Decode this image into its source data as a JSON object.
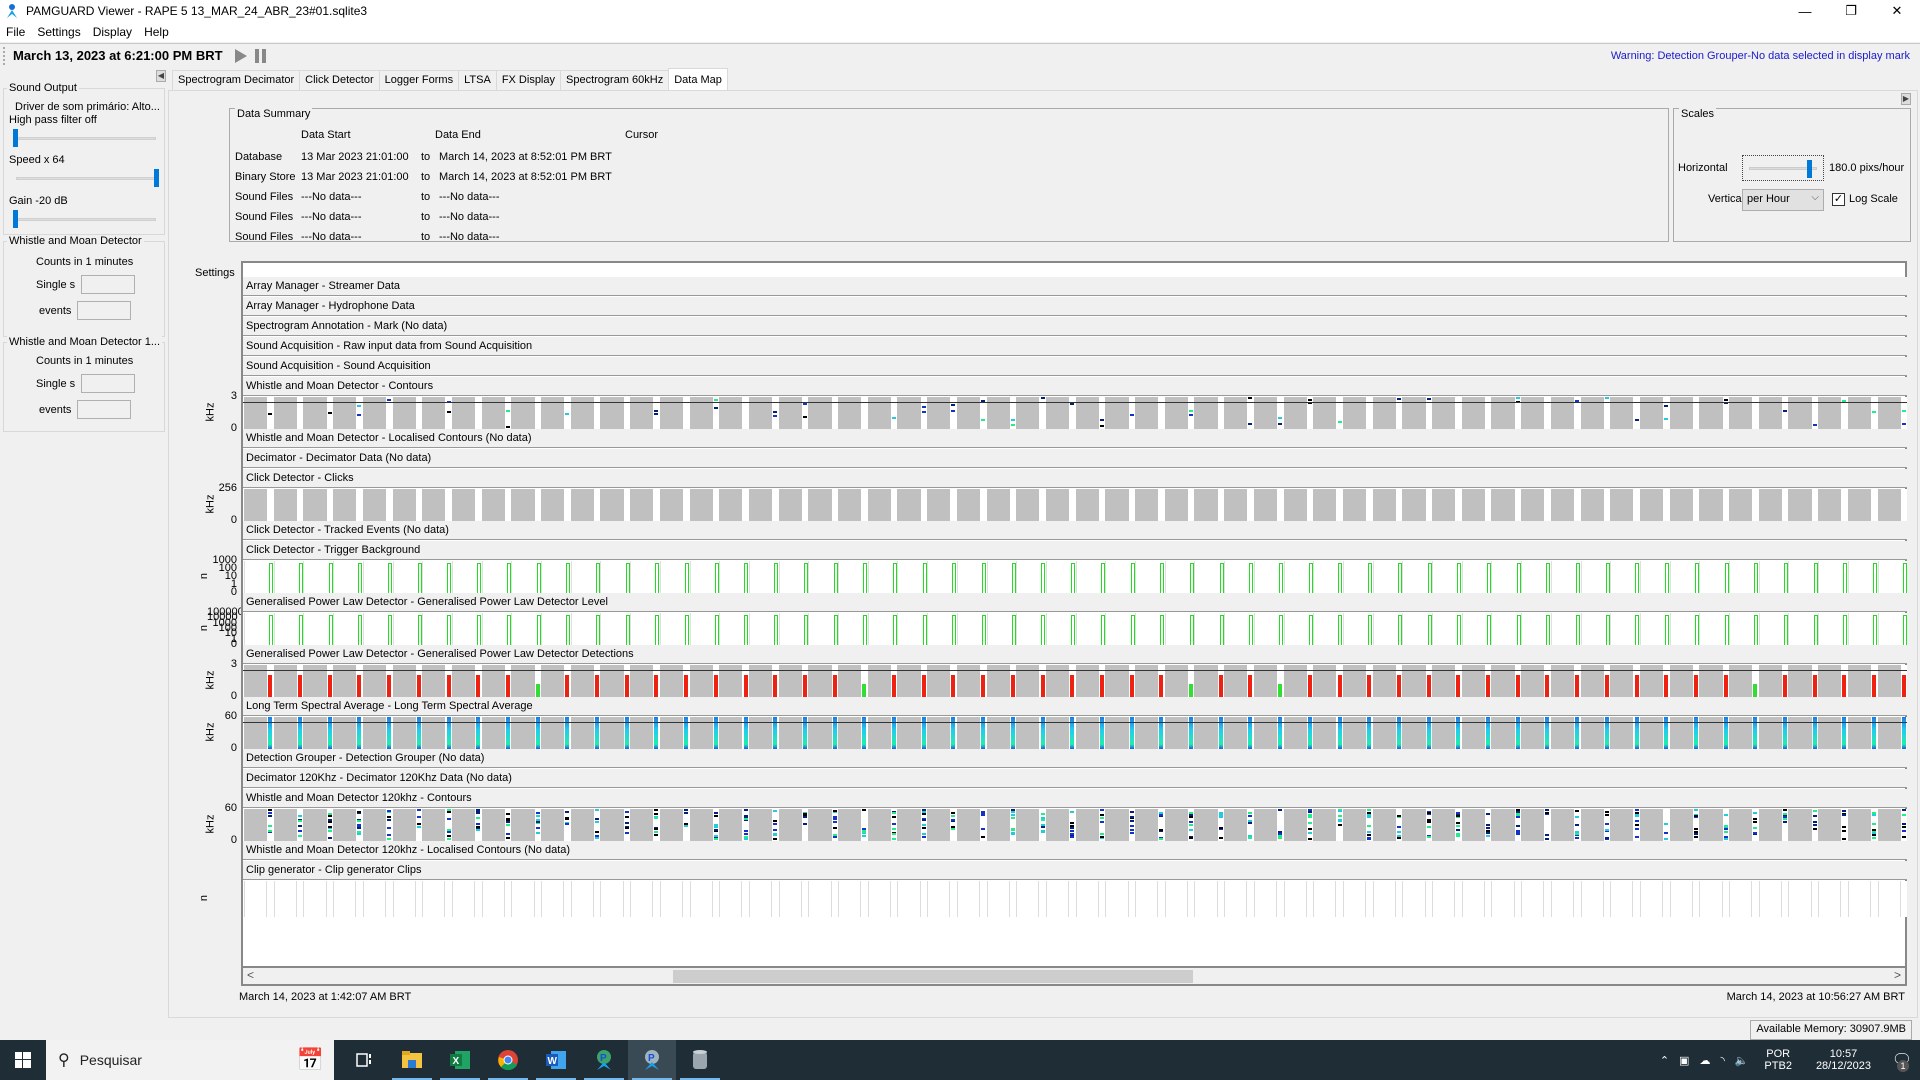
{
  "window": {
    "title": "PAMGUARD Viewer - RAPE 5 13_MAR_24_ABR_23#01.sqlite3",
    "controls": {
      "minimize": "—",
      "restore": "❐",
      "close": "✕"
    }
  },
  "menu": [
    "File",
    "Settings",
    "Display",
    "Help"
  ],
  "toolbar": {
    "clock": "March 13, 2023 at 6:21:00 PM BRT",
    "warning": "Warning: Detection Grouper-No data selected in display mark"
  },
  "left_panel": {
    "sound_output": {
      "title": "Sound Output",
      "driver": "Driver de som primário: Alto...",
      "high_pass": "High pass filter off",
      "high_pass_fraction": 0.0,
      "speed": "Speed  x 64",
      "speed_fraction": 1.0,
      "gain": "Gain -20 dB",
      "gain_fraction": 0.0
    },
    "wmd1": {
      "title": "Whistle and Moan Detector",
      "counts": "Counts in 1 minutes",
      "single": "Single s",
      "events": "events",
      "single_value": "",
      "events_value": ""
    },
    "wmd2": {
      "title": "Whistle and Moan Detector 1...",
      "counts": "Counts in 1 minutes",
      "single": "Single s",
      "events": "events",
      "single_value": "",
      "events_value": ""
    }
  },
  "tabs": [
    "Spectrogram Decimator",
    "Click Detector",
    "Logger Forms",
    "LTSA",
    "FX Display",
    "Spectrogram 60kHz",
    "Data Map"
  ],
  "active_tab": "Data Map",
  "data_summary": {
    "title": "Data Summary",
    "headers": {
      "start": "Data Start",
      "end": "Data End",
      "cursor": "Cursor"
    },
    "rows": [
      {
        "name": "Database",
        "start": "13 Mar 2023 21:01:00",
        "to": "to",
        "end": "March 14, 2023 at 8:52:01 PM BRT"
      },
      {
        "name": "Binary Store",
        "start": "13 Mar 2023 21:01:00",
        "to": "to",
        "end": "March 14, 2023 at 8:52:01 PM BRT"
      },
      {
        "name": "Sound Files",
        "start": "---No data---",
        "to": "to",
        "end": "---No data---"
      },
      {
        "name": "Sound Files",
        "start": "---No data---",
        "to": "to",
        "end": "---No data---"
      },
      {
        "name": "Sound Files",
        "start": "---No data---",
        "to": "to",
        "end": "---No data---"
      }
    ]
  },
  "scales": {
    "title": "Scales",
    "horizontal_label": "Horizontal",
    "horizontal_value": "180.0 pixs/hour",
    "vertical_label": "Vertical",
    "vertical_value": "per Hour",
    "log_scale_label": "Log Scale",
    "log_scale_checked": true,
    "check_glyph": "✓"
  },
  "datamap": {
    "settings_label": "Settings",
    "strips": [
      {
        "label": "Array Manager - Streamer Data"
      },
      {
        "label": "Array Manager - Hydrophone Data"
      },
      {
        "label": "Spectrogram Annotation - Mark  (No data)"
      },
      {
        "label": "Sound Acquisition - Raw input data from Sound Acquisition"
      },
      {
        "label": "Sound Acquisition - Sound Acquisition"
      },
      {
        "label": "Whistle and Moan Detector - Contours",
        "plot": "contours",
        "yunit": "kHz",
        "yticks": [
          "3",
          "0"
        ]
      },
      {
        "label": "Whistle and Moan Detector - Localised Contours  (No data)"
      },
      {
        "label": "Decimator - Decimator Data  (No data)"
      },
      {
        "label": "Click Detector - Clicks",
        "plot": "gray",
        "yunit": "kHz",
        "yticks": [
          "256",
          "0"
        ]
      },
      {
        "label": "Click Detector - Tracked Events  (No data)"
      },
      {
        "label": "Click Detector - Trigger Background",
        "plot": "green",
        "yunit": "n",
        "yticks": [
          "1000",
          "100",
          "10",
          "1",
          "0"
        ]
      },
      {
        "label": "Generalised Power Law Detector - Generalised Power Law Detector Level",
        "plot": "green",
        "yunit": "n",
        "yticks": [
          "100000",
          "10000",
          "1000",
          "100",
          "10",
          "1",
          "0"
        ]
      },
      {
        "label": "Generalised Power Law Detector - Generalised Power Law Detector Detections",
        "plot": "red",
        "yunit": "kHz",
        "yticks": [
          "3",
          "0"
        ]
      },
      {
        "label": "Long Term Spectral Average - Long Term Spectral Average",
        "plot": "ltsa",
        "yunit": "kHz",
        "yticks": [
          "60",
          "0"
        ]
      },
      {
        "label": "Detection Grouper - Detection Grouper  (No data)"
      },
      {
        "label": "Decimator 120Khz - Decimator 120Khz Data  (No data)"
      },
      {
        "label": "Whistle and Moan Detector 120khz - Contours",
        "plot": "contours120",
        "yunit": "kHz",
        "yticks": [
          "60",
          "0"
        ]
      },
      {
        "label": "Whistle and Moan Detector 120khz - Localised Contours  (No data)"
      },
      {
        "label": "Clip generator - Clip generator Clips",
        "plot": "clips",
        "yunit": "n",
        "yticks": []
      }
    ],
    "time_start": "March 14, 2023 at 1:42:07 AM BRT",
    "time_end": "March 14, 2023 at 10:56:27 AM BRT",
    "scroll_left": "<",
    "scroll_right": ">"
  },
  "status": {
    "memory": "Available Memory: 30907.9MB"
  },
  "taskbar": {
    "search_placeholder": "Pesquisar",
    "apps": [
      "task-view",
      "file-explorer",
      "excel",
      "chrome",
      "word",
      "pamguard",
      "pamguard-viewer",
      "database-tool"
    ],
    "tray": {
      "lang1": "POR",
      "lang2": "PTB2",
      "time": "10:57",
      "date": "28/12/2023",
      "notifications": "1"
    }
  },
  "colors": {
    "accent": "#0078d7",
    "warning": "#1a1acc",
    "plot_gray": "#c0c0c0",
    "green": "#22dd22",
    "red": "#ee2211",
    "taskbar": "#1f2d36"
  }
}
